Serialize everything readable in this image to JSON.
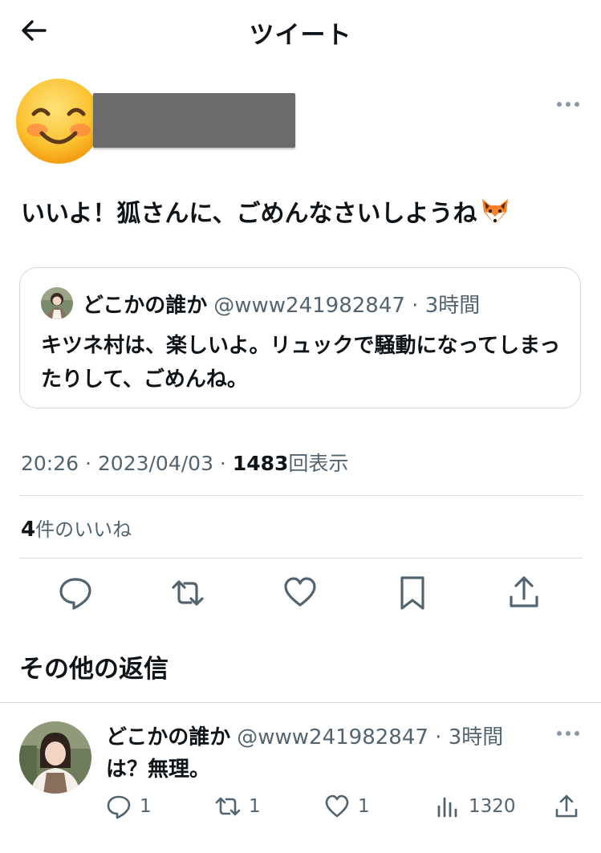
{
  "header": {
    "title": "ツイート"
  },
  "tweet": {
    "text": "いいよ！狐さんに、ごめんなさいしようね"
  },
  "quote": {
    "name": "どこかの誰か",
    "handle": "@www241982847",
    "time": "· 3時間",
    "text": "キツネ村は、楽しいよ。リュックで騒動になってしまったりして、ごめんね。"
  },
  "meta": {
    "time": "20:26 · 2023/04/03 · ",
    "views": "1483",
    "views_label": "回表示"
  },
  "likes": {
    "count": "4",
    "label": "件のいいね"
  },
  "section": {
    "title": "その他の返信"
  },
  "reply": {
    "name": "どこかの誰か",
    "handle": "@www241982847",
    "time": "· 3時間",
    "text": "は？無理。",
    "replies": "1",
    "retweets": "1",
    "likes": "1",
    "views": "1320"
  },
  "icons": {
    "accent": "#536471"
  }
}
